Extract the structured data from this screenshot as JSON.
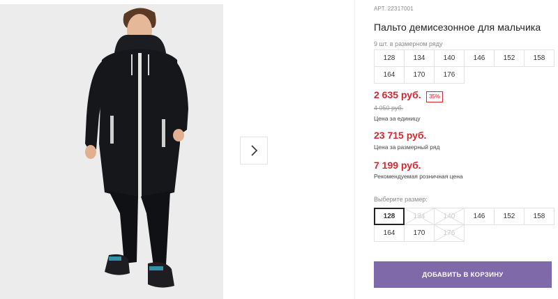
{
  "product": {
    "article": "АРТ. 22317001",
    "title": "Пальто демисезонное для мальчика",
    "size_count": "9 шт. в размерном ряду"
  },
  "size_row": [
    "128",
    "134",
    "140",
    "146",
    "152",
    "158",
    "164",
    "170",
    "176"
  ],
  "pricing": {
    "unit_price": "2 635 руб.",
    "discount": "35%",
    "old_price": "4 050 руб.",
    "unit_caption": "Цена за единицу",
    "row_price": "23 715 руб.",
    "row_caption": "Цена за размерный ряд",
    "retail_price": "7 199 руб.",
    "retail_caption": "Рекомендуемая розничная цена"
  },
  "size_select": {
    "label": "Выберите размер:",
    "options": [
      {
        "size": "128",
        "state": "selected"
      },
      {
        "size": "134",
        "state": "disabled"
      },
      {
        "size": "140",
        "state": "disabled"
      },
      {
        "size": "146",
        "state": "available"
      },
      {
        "size": "152",
        "state": "available"
      },
      {
        "size": "158",
        "state": "available"
      },
      {
        "size": "164",
        "state": "available"
      },
      {
        "size": "170",
        "state": "available"
      },
      {
        "size": "176",
        "state": "disabled"
      }
    ]
  },
  "actions": {
    "add_to_cart": "ДОБАВИТЬ В КОРЗИНУ",
    "next_icon": "chevron-right-icon"
  },
  "colors": {
    "price_red": "#d4272f",
    "button_purple": "#7f69a9",
    "jacket": "#15171b"
  }
}
